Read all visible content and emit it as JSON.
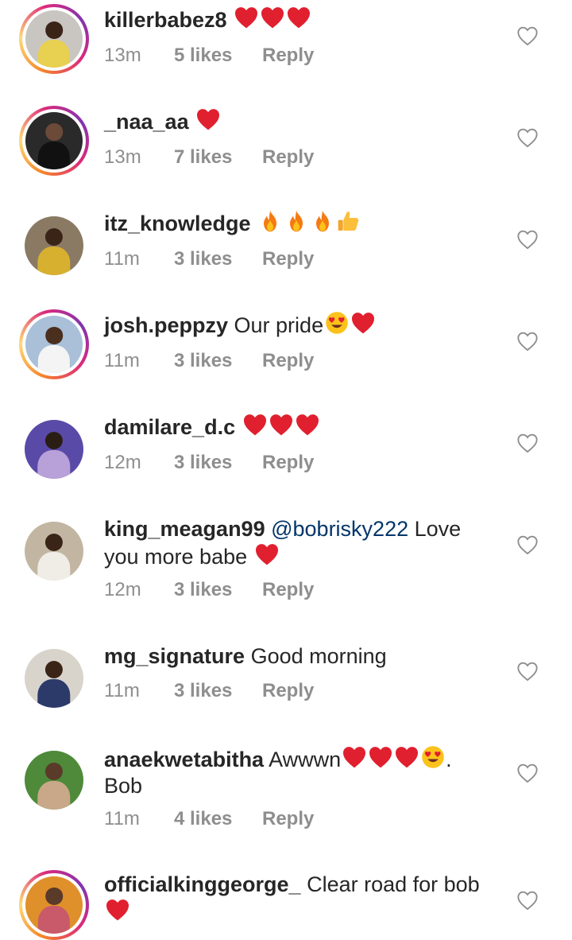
{
  "comments": [
    {
      "username": "killerbabez8",
      "text": "",
      "emojis": [
        "heart",
        "heart",
        "heart"
      ],
      "time": "13m",
      "likes": "5 likes",
      "reply": "Reply"
    },
    {
      "username": "_naa_aa",
      "text": "",
      "emojis": [
        "heart"
      ],
      "time": "13m",
      "likes": "7 likes",
      "reply": "Reply"
    },
    {
      "username": "itz_knowledge",
      "text": "",
      "emojis": [
        "fire",
        "fire",
        "fire",
        "thumbs-up"
      ],
      "time": "11m",
      "likes": "3 likes",
      "reply": "Reply"
    },
    {
      "username": "josh.peppzy",
      "text": "Our pride",
      "emojis": [
        "heart-eyes",
        "heart"
      ],
      "time": "11m",
      "likes": "3 likes",
      "reply": "Reply"
    },
    {
      "username": "damilare_d.c",
      "text": "",
      "emojis": [
        "heart",
        "heart",
        "heart"
      ],
      "time": "12m",
      "likes": "3 likes",
      "reply": "Reply"
    },
    {
      "username": "king_meagan99",
      "mention": "@bobrisky222",
      "text": "Love",
      "text2": "you more babe",
      "emojis2": [
        "heart"
      ],
      "time": "12m",
      "likes": "3 likes",
      "reply": "Reply"
    },
    {
      "username": "mg_signature",
      "text": "Good morning",
      "emojis": [],
      "time": "11m",
      "likes": "3 likes",
      "reply": "Reply"
    },
    {
      "username": "anaekwetabitha",
      "text": "Awwwn",
      "emojis": [
        "heart",
        "heart",
        "heart",
        "heart-eyes"
      ],
      "text_after": ".",
      "text2": "Bob",
      "time": "11m",
      "likes": "4 likes",
      "reply": "Reply"
    },
    {
      "username": "officialkinggeorge_",
      "text": "Clear road for bob",
      "emojis2": [
        "heart"
      ]
    }
  ],
  "colors": {
    "text": "#262626",
    "meta": "#8e8e8e",
    "mention": "#003569",
    "heart": "#e0202f"
  },
  "icons": {
    "like": "heart-outline-icon"
  }
}
